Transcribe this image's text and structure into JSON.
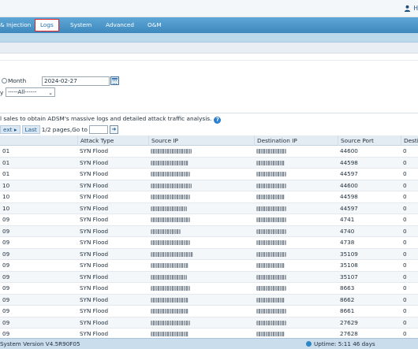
{
  "header": {
    "user_initial": "H"
  },
  "nav": {
    "items": [
      {
        "label": "& Injection"
      },
      {
        "label": "Logs"
      },
      {
        "label": "System"
      },
      {
        "label": "Advanced"
      },
      {
        "label": "O&M"
      }
    ],
    "active": "Logs"
  },
  "filters": {
    "month_label": "Month",
    "date_value": "2024-02-27",
    "type_label": "y",
    "type_selected": "-----All------"
  },
  "notice": "l sales to obtain ADSM's massive logs and detailed attack traffic analysis.",
  "pager": {
    "next_label": "ext",
    "last_label": "Last",
    "pages_text": "1/2 pages,Go to"
  },
  "table": {
    "columns": [
      "",
      "Attack Type",
      "Source IP",
      "Destination IP",
      "Source Port",
      "Destin"
    ],
    "rows": [
      {
        "c0": "01",
        "type": "SYN Flood",
        "src_port": "44600",
        "dst_port": "0"
      },
      {
        "c0": "01",
        "type": "SYN Flood",
        "src_port": "44598",
        "dst_port": "0"
      },
      {
        "c0": "01",
        "type": "SYN Flood",
        "src_port": "44597",
        "dst_port": "0"
      },
      {
        "c0": "10",
        "type": "SYN Flood",
        "src_port": "44600",
        "dst_port": "0"
      },
      {
        "c0": "10",
        "type": "SYN Flood",
        "src_port": "44598",
        "dst_port": "0"
      },
      {
        "c0": "10",
        "type": "SYN Flood",
        "src_port": "44597",
        "dst_port": "0"
      },
      {
        "c0": "09",
        "type": "SYN Flood",
        "src_port": "4741",
        "dst_port": "0"
      },
      {
        "c0": "09",
        "type": "SYN Flood",
        "src_port": "4740",
        "dst_port": "0"
      },
      {
        "c0": "09",
        "type": "SYN Flood",
        "src_port": "4738",
        "dst_port": "0"
      },
      {
        "c0": "09",
        "type": "SYN Flood",
        "src_port": "35109",
        "dst_port": "0"
      },
      {
        "c0": "09",
        "type": "SYN Flood",
        "src_port": "35108",
        "dst_port": "0"
      },
      {
        "c0": "09",
        "type": "SYN Flood",
        "src_port": "35107",
        "dst_port": "0"
      },
      {
        "c0": "09",
        "type": "SYN Flood",
        "src_port": "8663",
        "dst_port": "0"
      },
      {
        "c0": "09",
        "type": "SYN Flood",
        "src_port": "8662",
        "dst_port": "0"
      },
      {
        "c0": "09",
        "type": "SYN Flood",
        "src_port": "8661",
        "dst_port": "0"
      },
      {
        "c0": "09",
        "type": "SYN Flood",
        "src_port": "27629",
        "dst_port": "0"
      },
      {
        "c0": "09",
        "type": "SYN Flood",
        "src_port": "27628",
        "dst_port": "0"
      }
    ]
  },
  "footer": {
    "version": "System Version   V4.5R90F05",
    "uptime": "Uptime: 5:11 46 days"
  },
  "colors": {
    "nav": "#3d88bd",
    "active_outline": "#e02424",
    "accent": "#1e6ea6"
  }
}
